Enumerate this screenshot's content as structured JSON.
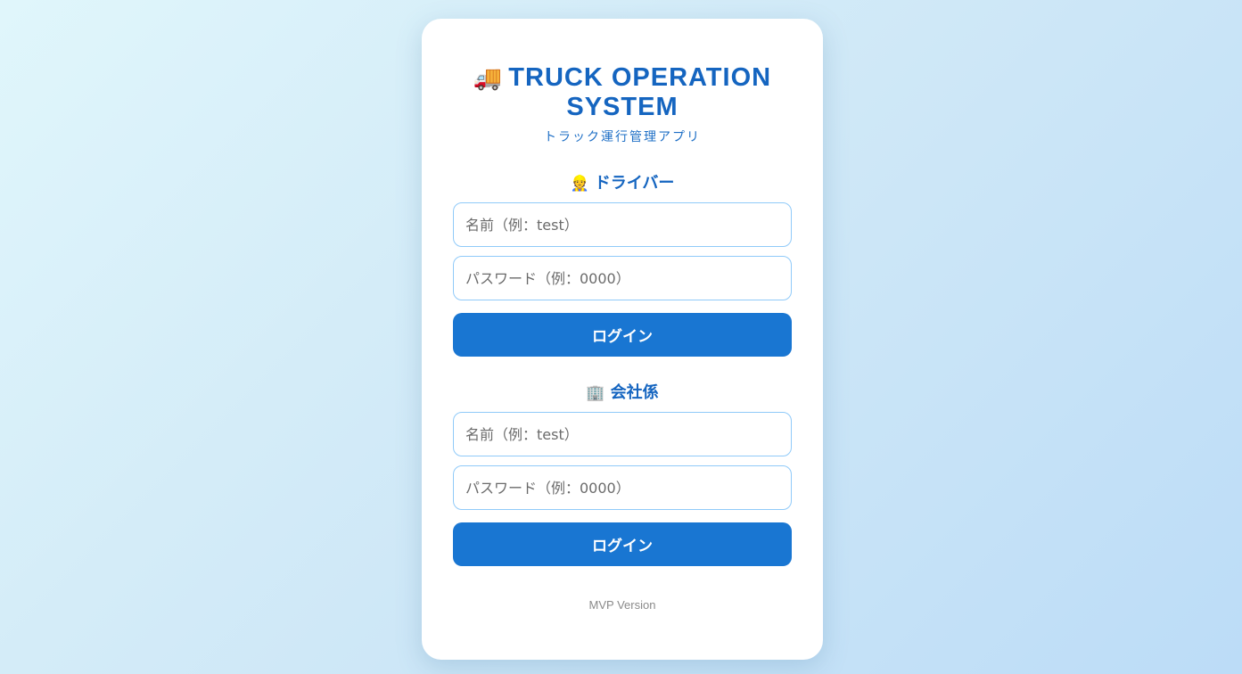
{
  "app": {
    "title_icon": "🚚",
    "title": "TRUCK OPERATION SYSTEM",
    "subtitle": "トラック運行管理アプリ"
  },
  "driver": {
    "icon": "👷",
    "heading": "ドライバー",
    "name_placeholder": "名前（例：test）",
    "password_placeholder": "パスワード（例：0000）",
    "login_label": "ログイン"
  },
  "company": {
    "icon": "🏢",
    "heading": "会社係",
    "name_placeholder": "名前（例：test）",
    "password_placeholder": "パスワード（例：0000）",
    "login_label": "ログイン"
  },
  "footer": {
    "version": "MVP Version"
  },
  "colors": {
    "accent": "#1976d2",
    "title": "#1565c0",
    "input_border": "#90caf9"
  }
}
